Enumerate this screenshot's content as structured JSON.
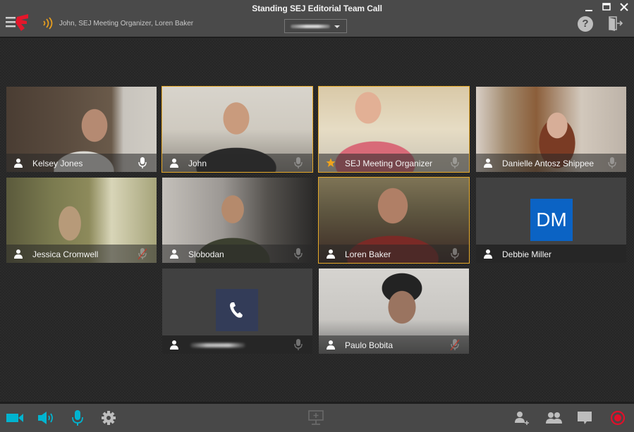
{
  "titlebar": {
    "meeting_title": "Standing SEJ Editorial Team Call",
    "speaking_now": "John, SEJ Meeting Organizer, Loren Baker",
    "room_selector": {
      "value_redacted": true,
      "icon": "chevron-down-icon"
    },
    "window_controls": [
      "minimize",
      "maximize",
      "close"
    ],
    "help_label": "?",
    "icons": {
      "menu": "hamburger-logo-icon",
      "speaking": "sound-waves-icon",
      "help": "help-icon",
      "exit": "exit-door-icon"
    }
  },
  "colors": {
    "accent": "#00b4d0",
    "active_speaker_border": "#e6a928",
    "record": "#e0102a",
    "logo_red": "#e4172b",
    "organizer_star": "#f0a31c",
    "avatar_dm": "#0b63c4",
    "avatar_phone": "#333c58"
  },
  "participants": [
    {
      "name": "Kelsey Jones",
      "role_icon": "person-icon",
      "mic": "active",
      "video": true,
      "speaking": false
    },
    {
      "name": "John",
      "role_icon": "person-icon",
      "mic": "idle",
      "video": true,
      "speaking": true
    },
    {
      "name": "SEJ Meeting Organizer",
      "role_icon": "star-icon",
      "mic": "idle",
      "video": true,
      "speaking": true
    },
    {
      "name": "Danielle Antosz Shippee",
      "role_icon": "person-icon",
      "mic": "idle",
      "video": true,
      "speaking": false
    },
    {
      "name": "Jessica Cromwell",
      "role_icon": "person-icon",
      "mic": "muted",
      "video": true,
      "speaking": false
    },
    {
      "name": "Slobodan",
      "role_icon": "person-icon",
      "mic": "idle",
      "video": true,
      "speaking": false
    },
    {
      "name": "Loren Baker",
      "role_icon": "person-icon",
      "mic": "idle",
      "video": true,
      "speaking": true
    },
    {
      "name": "Debbie Miller",
      "role_icon": "person-icon",
      "mic": "none",
      "video": false,
      "avatar_initials": "DM",
      "speaking": false
    },
    {
      "name": "",
      "name_redacted": true,
      "role_icon": "person-icon",
      "mic": "idle",
      "video": false,
      "avatar_icon": "phone-icon",
      "speaking": false
    },
    {
      "name": "Paulo Bobita",
      "role_icon": "person-icon",
      "mic": "muted",
      "video": true,
      "speaking": false
    }
  ],
  "toolbar": {
    "left": [
      {
        "id": "video",
        "icon": "video-camera-icon",
        "state": "on"
      },
      {
        "id": "speaker",
        "icon": "speaker-icon",
        "state": "on"
      },
      {
        "id": "microphone",
        "icon": "microphone-icon",
        "state": "on"
      },
      {
        "id": "settings",
        "icon": "gear-icon"
      }
    ],
    "center": [
      {
        "id": "share-screen",
        "icon": "share-screen-icon",
        "state": "disabled"
      }
    ],
    "right": [
      {
        "id": "invite",
        "icon": "add-person-icon"
      },
      {
        "id": "participants",
        "icon": "participants-icon"
      },
      {
        "id": "chat",
        "icon": "chat-bubble-icon"
      },
      {
        "id": "record",
        "icon": "record-icon",
        "state": "recording"
      }
    ]
  }
}
